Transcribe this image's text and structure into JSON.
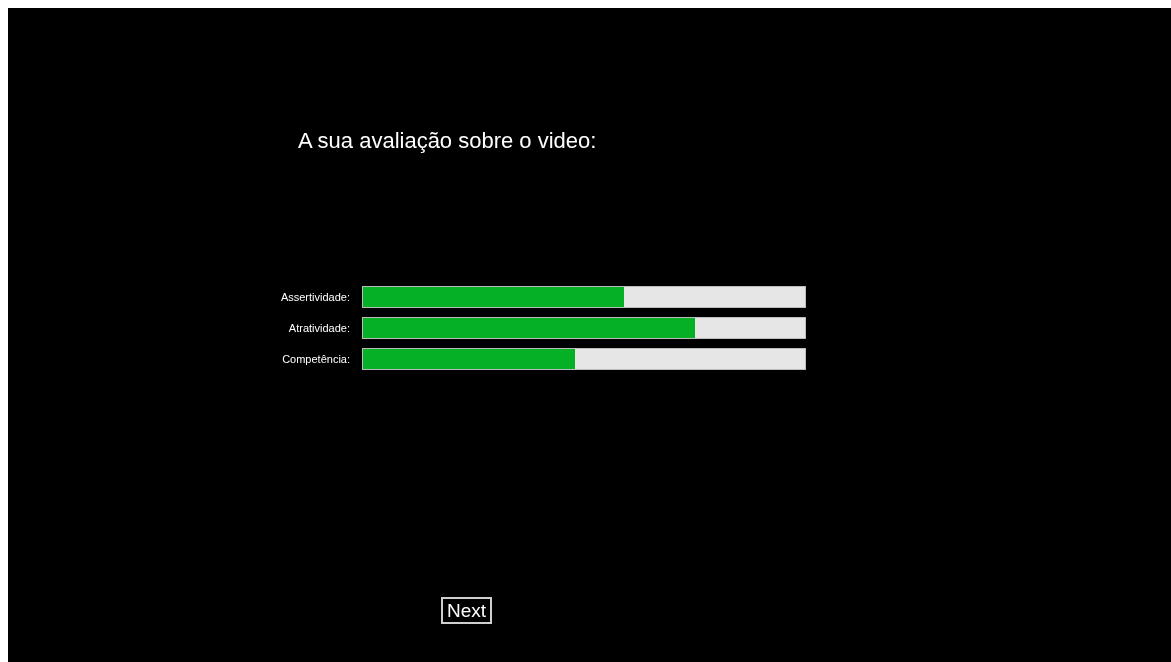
{
  "title": "A sua avaliação sobre o video:",
  "ratings": [
    {
      "label": "Assertividade:",
      "level": 0.59
    },
    {
      "label": "Atratividade:",
      "level": 0.75
    },
    {
      "label": "Competência:",
      "level": 0.48
    }
  ],
  "buttons": [
    "Next"
  ]
}
